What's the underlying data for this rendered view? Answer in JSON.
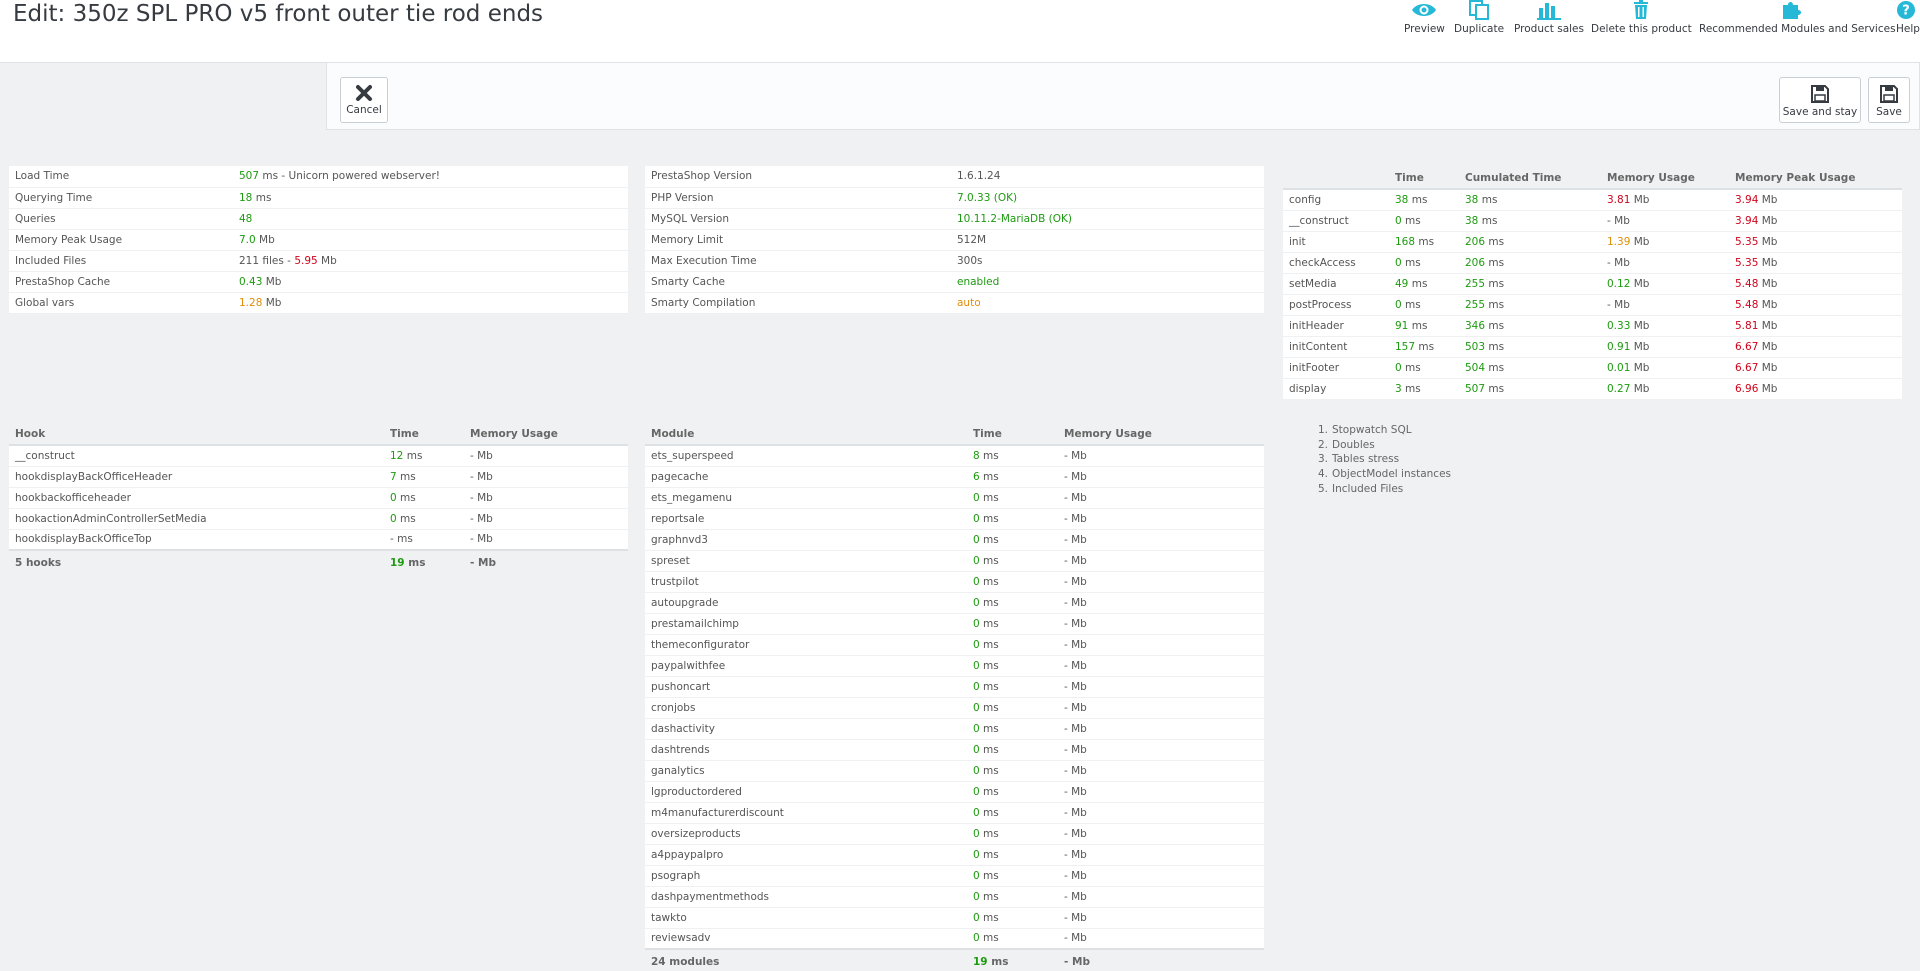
{
  "header": {
    "title": "Edit: 350z SPL PRO v5 front outer tie rod ends",
    "toolbar": [
      {
        "label": "Preview",
        "icon": "eye-icon"
      },
      {
        "label": "Duplicate",
        "icon": "copy-icon"
      },
      {
        "label": "Product sales",
        "icon": "bar-chart-icon"
      },
      {
        "label": "Delete this product",
        "icon": "trash-icon"
      },
      {
        "label": "Recommended Modules and Services",
        "icon": "puzzle-icon"
      },
      {
        "label": "Help",
        "icon": "help-icon"
      }
    ]
  },
  "actions": {
    "cancel": "Cancel",
    "save_and_stay": "Save and stay",
    "save": "Save"
  },
  "colors": {
    "good": "#1d9b10",
    "bad": "#d0021b",
    "warn": "#e08e0b",
    "accent": "#25b9d7"
  },
  "perf": {
    "load_time": {
      "label": "Load Time",
      "value": "507",
      "unit": "ms - Unicorn powered webserver!"
    },
    "querying_time": {
      "label": "Querying Time",
      "value": "18",
      "unit": "ms"
    },
    "queries": {
      "label": "Queries",
      "value": "48"
    },
    "memory_peak": {
      "label": "Memory Peak Usage",
      "value": "7.0",
      "unit": "Mb"
    },
    "included_files": {
      "label": "Included Files",
      "files": "211 files - ",
      "value": "5.95",
      "unit": "Mb"
    },
    "ps_cache": {
      "label": "PrestaShop Cache",
      "value": "0.43",
      "unit": "Mb"
    },
    "global_vars": {
      "label": "Global vars",
      "value": "1.28",
      "unit": "Mb"
    }
  },
  "config": {
    "ps_version": {
      "label": "PrestaShop Version",
      "value": "1.6.1.24"
    },
    "php_version": {
      "label": "PHP Version",
      "value": "7.0.33 (OK)"
    },
    "mysql_version": {
      "label": "MySQL Version",
      "value": "10.11.2-MariaDB (OK)"
    },
    "memory_limit": {
      "label": "Memory Limit",
      "value": "512M"
    },
    "max_exec": {
      "label": "Max Execution Time",
      "value": "300s"
    },
    "smarty_cache": {
      "label": "Smarty Cache",
      "value": "enabled"
    },
    "smarty_compilation": {
      "label": "Smarty Compilation",
      "value": "auto"
    }
  },
  "steps": {
    "headers": [
      "",
      "Time",
      "Cumulated Time",
      "Memory Usage",
      "Memory Peak Usage"
    ],
    "rows": [
      {
        "name": "config",
        "time": "38",
        "cum": "38",
        "mem": "3.81",
        "memc": "r",
        "peak": "3.94"
      },
      {
        "name": "__construct",
        "time": "0",
        "cum": "38",
        "mem": "-",
        "memc": "",
        "peak": "3.94"
      },
      {
        "name": "init",
        "time": "168",
        "cum": "206",
        "mem": "1.39",
        "memc": "o",
        "peak": "5.35"
      },
      {
        "name": "checkAccess",
        "time": "0",
        "cum": "206",
        "mem": "-",
        "memc": "",
        "peak": "5.35"
      },
      {
        "name": "setMedia",
        "time": "49",
        "cum": "255",
        "mem": "0.12",
        "memc": "g",
        "peak": "5.48"
      },
      {
        "name": "postProcess",
        "time": "0",
        "cum": "255",
        "mem": "-",
        "memc": "",
        "peak": "5.48"
      },
      {
        "name": "initHeader",
        "time": "91",
        "cum": "346",
        "mem": "0.33",
        "memc": "g",
        "peak": "5.81"
      },
      {
        "name": "initContent",
        "time": "157",
        "cum": "503",
        "mem": "0.91",
        "memc": "g",
        "peak": "6.67"
      },
      {
        "name": "initFooter",
        "time": "0",
        "cum": "504",
        "mem": "0.01",
        "memc": "g",
        "peak": "6.67"
      },
      {
        "name": "display",
        "time": "3",
        "cum": "507",
        "mem": "0.27",
        "memc": "g",
        "peak": "6.96"
      }
    ]
  },
  "hooks": {
    "headers": [
      "Hook",
      "Time",
      "Memory Usage"
    ],
    "rows": [
      {
        "name": "__construct",
        "time": "12",
        "mem": "- Mb"
      },
      {
        "name": "hookdisplayBackOfficeHeader",
        "time": "7",
        "mem": "- Mb"
      },
      {
        "name": "hookbackofficeheader",
        "time": "0",
        "mem": "- Mb"
      },
      {
        "name": "hookactionAdminControllerSetMedia",
        "time": "0",
        "mem": "- Mb"
      },
      {
        "name": "hookdisplayBackOfficeTop",
        "time": "-",
        "mem": "- Mb"
      }
    ],
    "footer": {
      "name": "5 hooks",
      "time": "19",
      "mem": "- Mb"
    }
  },
  "modules": {
    "headers": [
      "Module",
      "Time",
      "Memory Usage"
    ],
    "rows": [
      {
        "name": "ets_superspeed",
        "time": "8"
      },
      {
        "name": "pagecache",
        "time": "6"
      },
      {
        "name": "ets_megamenu",
        "time": "0"
      },
      {
        "name": "reportsale",
        "time": "0"
      },
      {
        "name": "graphnvd3",
        "time": "0"
      },
      {
        "name": "spreset",
        "time": "0"
      },
      {
        "name": "trustpilot",
        "time": "0"
      },
      {
        "name": "autoupgrade",
        "time": "0"
      },
      {
        "name": "prestamailchimp",
        "time": "0"
      },
      {
        "name": "themeconfigurator",
        "time": "0"
      },
      {
        "name": "paypalwithfee",
        "time": "0"
      },
      {
        "name": "pushoncart",
        "time": "0"
      },
      {
        "name": "cronjobs",
        "time": "0"
      },
      {
        "name": "dashactivity",
        "time": "0"
      },
      {
        "name": "dashtrends",
        "time": "0"
      },
      {
        "name": "ganalytics",
        "time": "0"
      },
      {
        "name": "lgproductordered",
        "time": "0"
      },
      {
        "name": "m4manufacturerdiscount",
        "time": "0"
      },
      {
        "name": "oversizeproducts",
        "time": "0"
      },
      {
        "name": "a4ppaypalpro",
        "time": "0"
      },
      {
        "name": "psograph",
        "time": "0"
      },
      {
        "name": "dashpaymentmethods",
        "time": "0"
      },
      {
        "name": "tawkto",
        "time": "0"
      },
      {
        "name": "reviewsadv",
        "time": "0"
      }
    ],
    "mem": "- Mb",
    "footer": {
      "name": "24 modules",
      "time": "19",
      "mem": "- Mb"
    }
  },
  "units": {
    "ms": "ms",
    "mb": "Mb"
  },
  "debug_links": [
    "Stopwatch SQL",
    "Doubles",
    "Tables stress",
    "ObjectModel instances",
    "Included Files"
  ]
}
